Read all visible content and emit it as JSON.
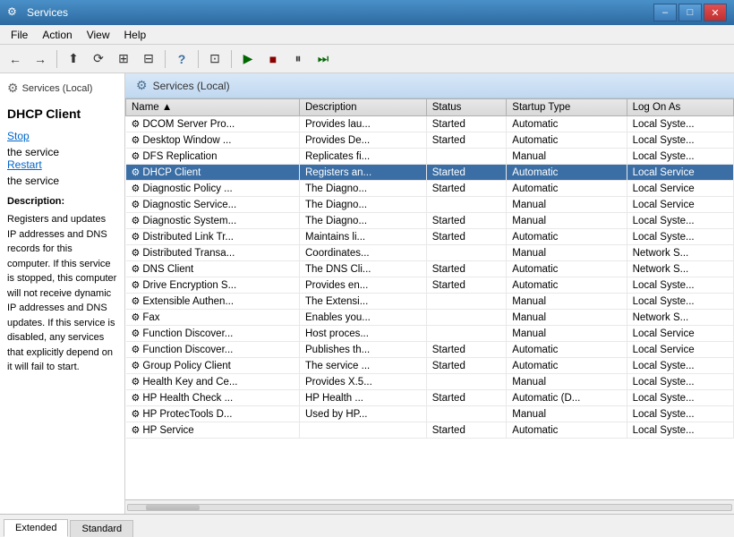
{
  "window": {
    "title": "Services",
    "min_label": "–",
    "max_label": "□",
    "close_label": "✕"
  },
  "menubar": {
    "items": [
      "File",
      "Action",
      "View",
      "Help"
    ]
  },
  "toolbar": {
    "buttons": [
      {
        "name": "back-btn",
        "icon": "←"
      },
      {
        "name": "forward-btn",
        "icon": "→"
      },
      {
        "name": "up-btn",
        "icon": "⬆"
      },
      {
        "name": "refresh-btn",
        "icon": "⟳"
      },
      {
        "name": "properties-btn",
        "icon": "⊞"
      },
      {
        "name": "map-btn",
        "icon": "⊟"
      },
      {
        "name": "help-btn",
        "icon": "?"
      },
      {
        "name": "explorer-btn",
        "icon": "⊡"
      },
      {
        "name": "play-btn",
        "icon": "▶"
      },
      {
        "name": "stop-btn",
        "icon": "■"
      },
      {
        "name": "pause-btn",
        "icon": "⏸"
      },
      {
        "name": "resume-btn",
        "icon": "⏭"
      }
    ]
  },
  "sidebar": {
    "header": "Services (Local)",
    "selected_service": "DHCP Client",
    "stop_link": "Stop",
    "restart_link": "Restart",
    "stop_suffix": " the service",
    "restart_suffix": " the service",
    "desc_header": "Description:",
    "description": "Registers and updates IP addresses and DNS records for this computer. If this service is stopped, this computer will not receive dynamic IP addresses and DNS updates. If this service is disabled, any services that explicitly depend on it will fail to start."
  },
  "content": {
    "header": "Services (Local)",
    "columns": [
      "Name",
      "Description",
      "Status",
      "Startup Type",
      "Log On As"
    ],
    "name_sort_indicator": "▲"
  },
  "services": [
    {
      "name": "DCOM Server Pro...",
      "description": "Provides lau...",
      "status": "Started",
      "startup": "Automatic",
      "logon": "Local Syste..."
    },
    {
      "name": "Desktop Window ...",
      "description": "Provides De...",
      "status": "Started",
      "startup": "Automatic",
      "logon": "Local Syste..."
    },
    {
      "name": "DFS Replication",
      "description": "Replicates fi...",
      "status": "",
      "startup": "Manual",
      "logon": "Local Syste..."
    },
    {
      "name": "DHCP Client",
      "description": "Registers an...",
      "status": "Started",
      "startup": "Automatic",
      "logon": "Local Service",
      "selected": true
    },
    {
      "name": "Diagnostic Policy ...",
      "description": "The Diagno...",
      "status": "Started",
      "startup": "Automatic",
      "logon": "Local Service"
    },
    {
      "name": "Diagnostic Service...",
      "description": "The Diagno...",
      "status": "",
      "startup": "Manual",
      "logon": "Local Service"
    },
    {
      "name": "Diagnostic System...",
      "description": "The Diagno...",
      "status": "Started",
      "startup": "Manual",
      "logon": "Local Syste..."
    },
    {
      "name": "Distributed Link Tr...",
      "description": "Maintains li...",
      "status": "Started",
      "startup": "Automatic",
      "logon": "Local Syste..."
    },
    {
      "name": "Distributed Transa...",
      "description": "Coordinates...",
      "status": "",
      "startup": "Manual",
      "logon": "Network S..."
    },
    {
      "name": "DNS Client",
      "description": "The DNS Cli...",
      "status": "Started",
      "startup": "Automatic",
      "logon": "Network S..."
    },
    {
      "name": "Drive Encryption S...",
      "description": "Provides en...",
      "status": "Started",
      "startup": "Automatic",
      "logon": "Local Syste..."
    },
    {
      "name": "Extensible Authen...",
      "description": "The Extensi...",
      "status": "",
      "startup": "Manual",
      "logon": "Local Syste..."
    },
    {
      "name": "Fax",
      "description": "Enables you...",
      "status": "",
      "startup": "Manual",
      "logon": "Network S..."
    },
    {
      "name": "Function Discover...",
      "description": "Host proces...",
      "status": "",
      "startup": "Manual",
      "logon": "Local Service"
    },
    {
      "name": "Function Discover...",
      "description": "Publishes th...",
      "status": "Started",
      "startup": "Automatic",
      "logon": "Local Service"
    },
    {
      "name": "Group Policy Client",
      "description": "The service ...",
      "status": "Started",
      "startup": "Automatic",
      "logon": "Local Syste..."
    },
    {
      "name": "Health Key and Ce...",
      "description": "Provides X.5...",
      "status": "",
      "startup": "Manual",
      "logon": "Local Syste..."
    },
    {
      "name": "HP Health Check ...",
      "description": "HP Health ...",
      "status": "Started",
      "startup": "Automatic (D...",
      "logon": "Local Syste..."
    },
    {
      "name": "HP ProtecTools D...",
      "description": "Used by HP...",
      "status": "",
      "startup": "Manual",
      "logon": "Local Syste..."
    },
    {
      "name": "HP Service",
      "description": "",
      "status": "Started",
      "startup": "Automatic",
      "logon": "Local Syste..."
    }
  ],
  "tabs": [
    {
      "label": "Extended",
      "active": true
    },
    {
      "label": "Standard",
      "active": false
    }
  ],
  "colors": {
    "selected_bg": "#3a6ea5",
    "selected_text": "#ffffff",
    "accent": "#3a6ea5"
  }
}
